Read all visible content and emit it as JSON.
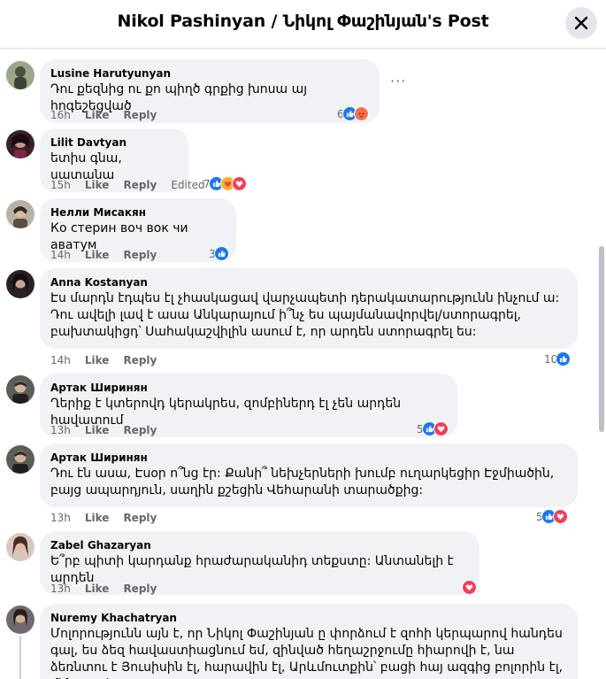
{
  "header": {
    "title": "Nikol Pashinyan / Նիկոլ Փաշինյան's Post"
  },
  "colors": {
    "like": "#1877f2",
    "love": "#f33e58",
    "angry": "#f7714c",
    "care": "#f7b125",
    "meta": "#65676b",
    "bubble": "#f0f2f5"
  },
  "labels": {
    "like": "Like",
    "reply": "Reply",
    "edited": "Edited"
  },
  "comments": [
    {
      "author": "Lusine Harutyunyan",
      "text": "Դու քեզնից ու քո պիղծ գրքից խոսա այ հոգեշեցված",
      "time": "16h",
      "edited": "",
      "count": "6",
      "reactions": [
        "like-icon",
        "angry-icon"
      ]
    },
    {
      "author": "Lilit Davtyan",
      "text": "ետիս գնա, սատանա",
      "time": "15h",
      "edited": "Edited",
      "count": "7",
      "reactions": [
        "like-icon",
        "care-icon",
        "love-icon"
      ]
    },
    {
      "author": "Нелли Мисакян",
      "text": "Ко стерин воч вок чи аватум",
      "time": "14h",
      "edited": "",
      "count": "3",
      "reactions": [
        "like-icon"
      ]
    },
    {
      "author": "Anna Kostanyan",
      "text": "Էս մարդն էդպես էլ չհասկացավ վարչապետի դերակատարությունն ինչում ա: Դու ավելի լավ է ասա Անկարայում ի՞նչ ես պայմանավորվել/ստորագրել, բախտակիցդ՝ Սահակաշվիլին ասում է, որ արդեն ստորագրել ես:",
      "time": "14h",
      "edited": "",
      "count": "10",
      "reactions": [
        "like-icon"
      ]
    },
    {
      "author": "Артак Ширинян",
      "text": "Ղերիք է կտերովդ կերակրես, զոմբիներդ էլ չեն արդեն հավատում",
      "time": "13h",
      "edited": "",
      "count": "5",
      "reactions": [
        "like-icon",
        "love-icon"
      ]
    },
    {
      "author": "Артак Ширинян",
      "text": "Դու էն ասա, Էսօր ո՞նց էր: Քանի՞ նեխչերների խումբ ուղարկեցիր Էջմիածին, բայց ապարդյուն, սաղին քշեցին Վեհարանի տարածքից:",
      "time": "13h",
      "edited": "",
      "count": "5",
      "reactions": [
        "like-icon",
        "love-icon"
      ]
    },
    {
      "author": "Zabel Ghazaryan",
      "text": "Ե՞րբ պիտի կարդանք հրաժարականիդ տեքստը: Անտանելի է արդեն",
      "time": "13h",
      "edited": "",
      "count": "",
      "reactions": [
        "love-icon"
      ]
    },
    {
      "author": "Nuremy Khachatryan",
      "text": "Մոլորությունն այն է, որ Նիկոլ Փաշինյան ը փորձում է զոհի կերպարով հանդես գալ, ես ձեզ հավաստիացնում եմ, զինված հեղաշրջումը հիարովի է, նա ձեռնտու է Յուսիսին էլ, հարավին էլ, Արևմուտքին՝ բացի հայ ազգից բոլորին էլ, մենք լավ",
      "time": "",
      "edited": "",
      "count": "",
      "reactions": []
    }
  ]
}
